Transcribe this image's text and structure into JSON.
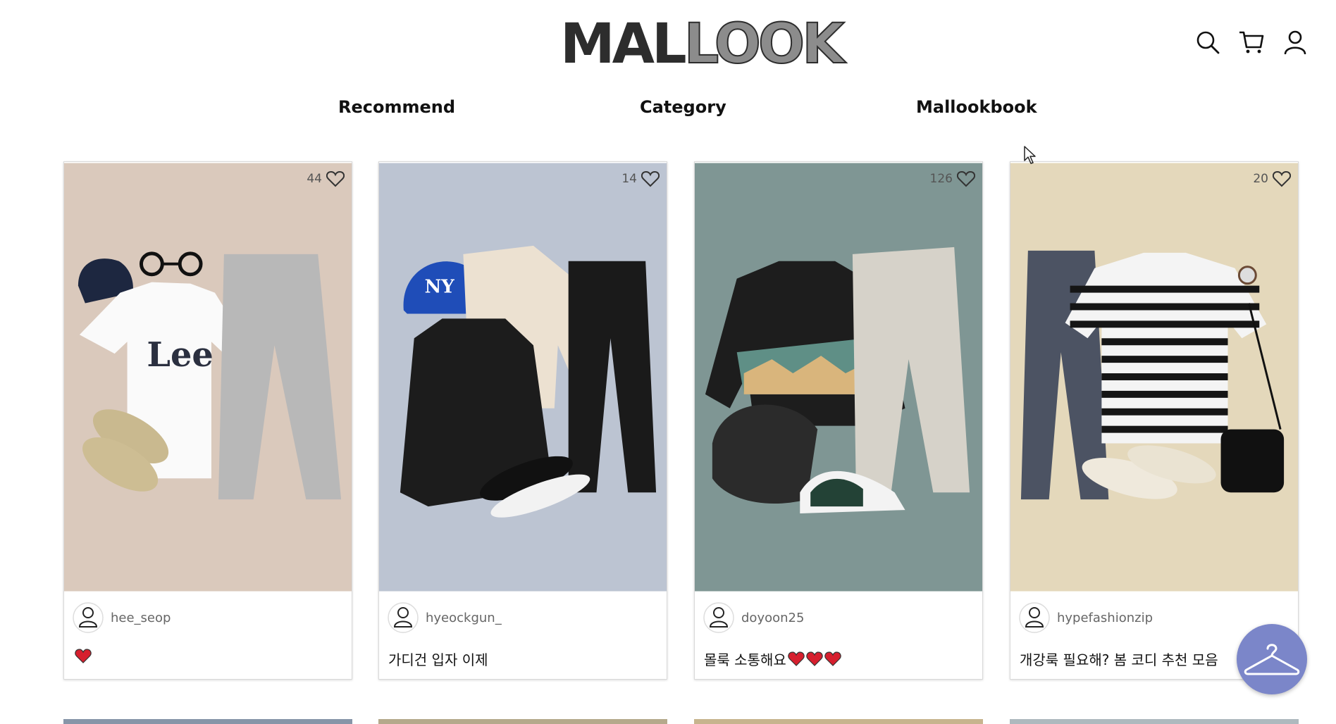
{
  "header": {
    "logo_part1": "MAL",
    "logo_part2": "LOOK",
    "icons": [
      "search-icon",
      "cart-icon",
      "user-icon"
    ]
  },
  "nav": {
    "recommend": "Recommend",
    "category": "Category",
    "mallookbook": "Mallookbook"
  },
  "posts": [
    {
      "likes": "44",
      "author": "hee_seop",
      "caption": "",
      "caption_hearts": 1,
      "bg_color": "#dac9bc"
    },
    {
      "likes": "14",
      "author": "hyeockgun_",
      "caption": "가디건 입자 이제",
      "caption_hearts": 0,
      "bg_color": "#bcc4d2"
    },
    {
      "likes": "126",
      "author": "doyoon25",
      "caption": "몰룩 소통해요",
      "caption_hearts": 3,
      "bg_color": "#7f9694"
    },
    {
      "likes": "20",
      "author": "hypefashionzip",
      "caption": "개강룩 필요해? 봄 코디 추천 모음",
      "caption_hearts": 0,
      "bg_color": "#e4d8bb"
    }
  ],
  "next_row_colors": [
    "#8795a8",
    "#b5a98c",
    "#c7b48e",
    "#aeb9be"
  ],
  "colors": {
    "fab": "#7b86c9",
    "heart_red": "#d61f2e"
  },
  "fab_icon": "hanger-icon"
}
